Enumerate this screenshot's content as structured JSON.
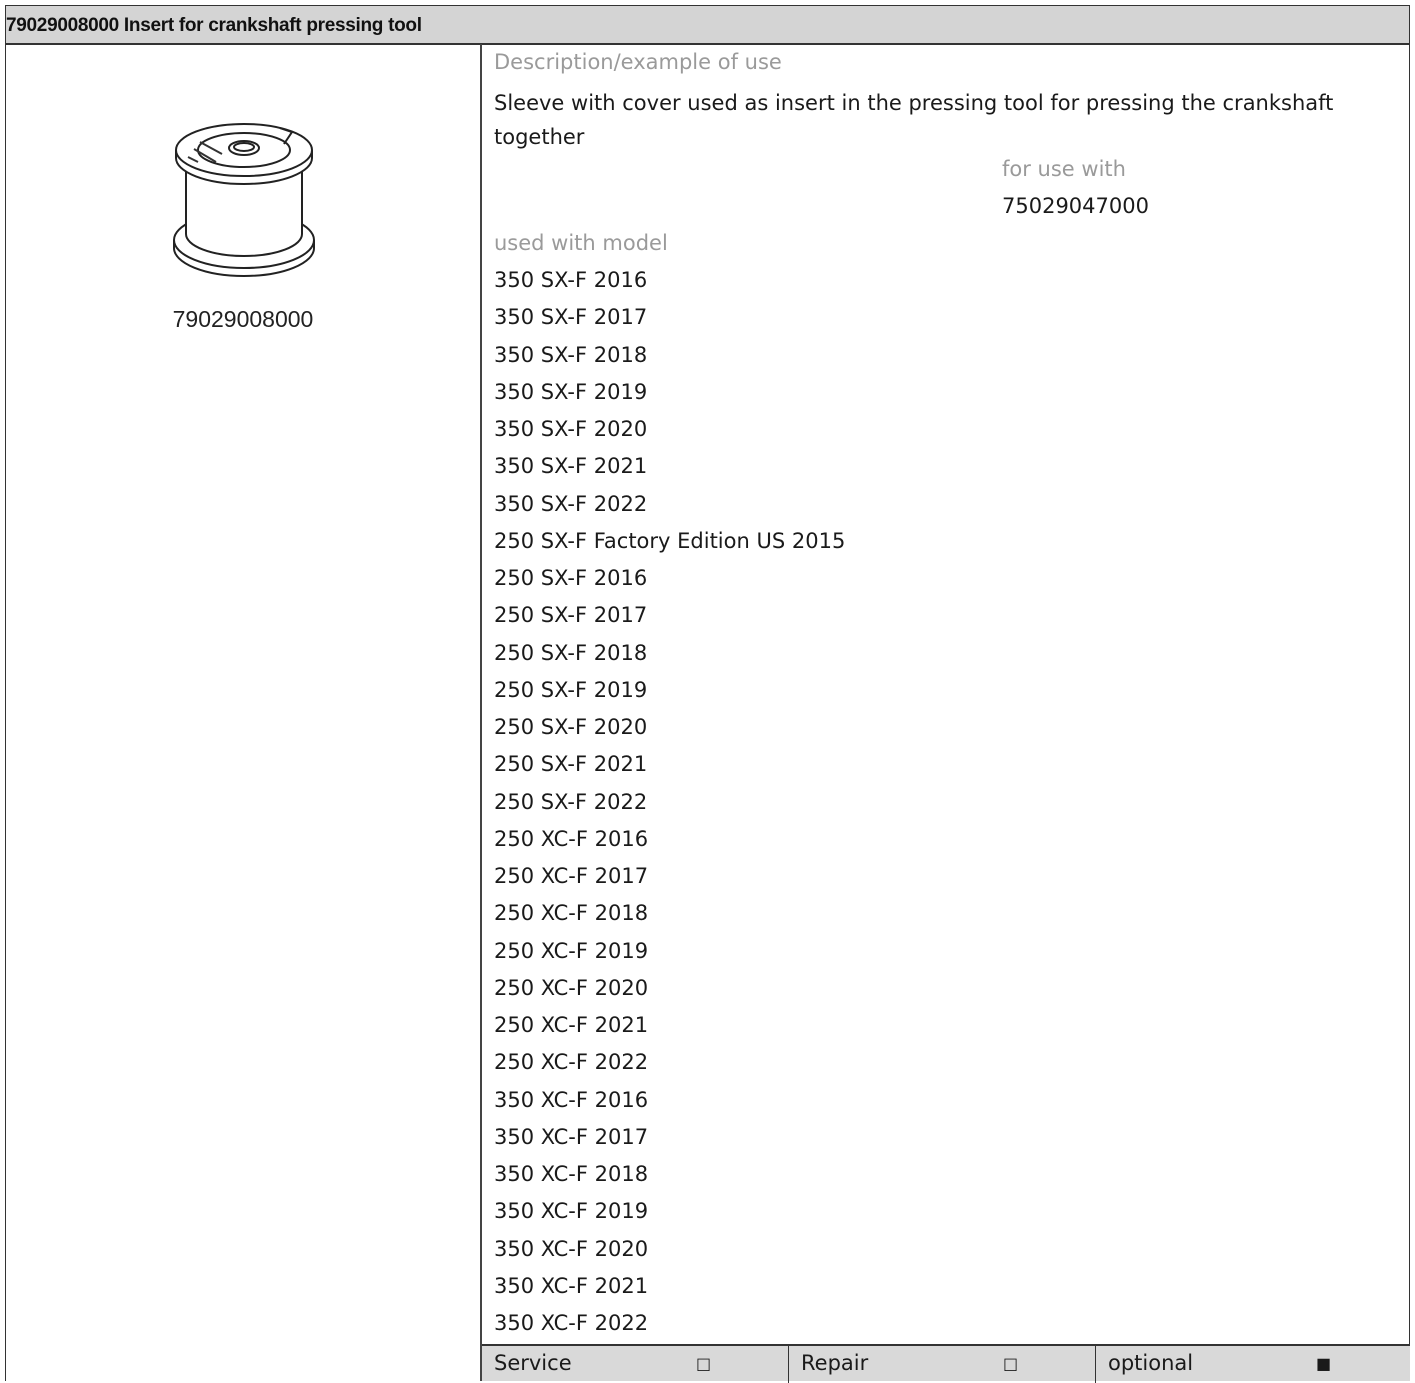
{
  "header": {
    "title": "79029008000 Insert for crankshaft pressing tool"
  },
  "tool": {
    "part_number": "79029008000",
    "image_icon": "sleeve-insert-icon"
  },
  "description": {
    "label": "Description/example of use",
    "text": "Sleeve with cover used as insert in the pressing tool for pressing the crankshaft together"
  },
  "for_use_with": {
    "label": "for use with",
    "value": "75029047000"
  },
  "used_with_model": {
    "label": "used with model",
    "models": [
      "350 SX-F 2016",
      "350 SX-F 2017",
      "350 SX-F 2018",
      "350 SX-F 2019",
      "350 SX-F 2020",
      "350 SX-F 2021",
      "350 SX-F 2022",
      "250 SX-F Factory Edition US 2015",
      "250 SX-F 2016",
      "250 SX-F 2017",
      "250 SX-F 2018",
      "250 SX-F 2019",
      "250 SX-F 2020",
      "250 SX-F 2021",
      "250 SX-F 2022",
      "250 XC-F 2016",
      "250 XC-F 2017",
      "250 XC-F 2018",
      "250 XC-F 2019",
      "250 XC-F 2020",
      "250 XC-F 2021",
      "250 XC-F 2022",
      "350 XC-F 2016",
      "350 XC-F 2017",
      "350 XC-F 2018",
      "350 XC-F 2019",
      "350 XC-F 2020",
      "350 XC-F 2021",
      "350 XC-F 2022"
    ]
  },
  "footer": {
    "service": {
      "label": "Service",
      "checked": false,
      "mark": "□"
    },
    "repair": {
      "label": "Repair",
      "checked": false,
      "mark": "□"
    },
    "optional": {
      "label": "optional",
      "checked": true,
      "mark": "■"
    }
  }
}
